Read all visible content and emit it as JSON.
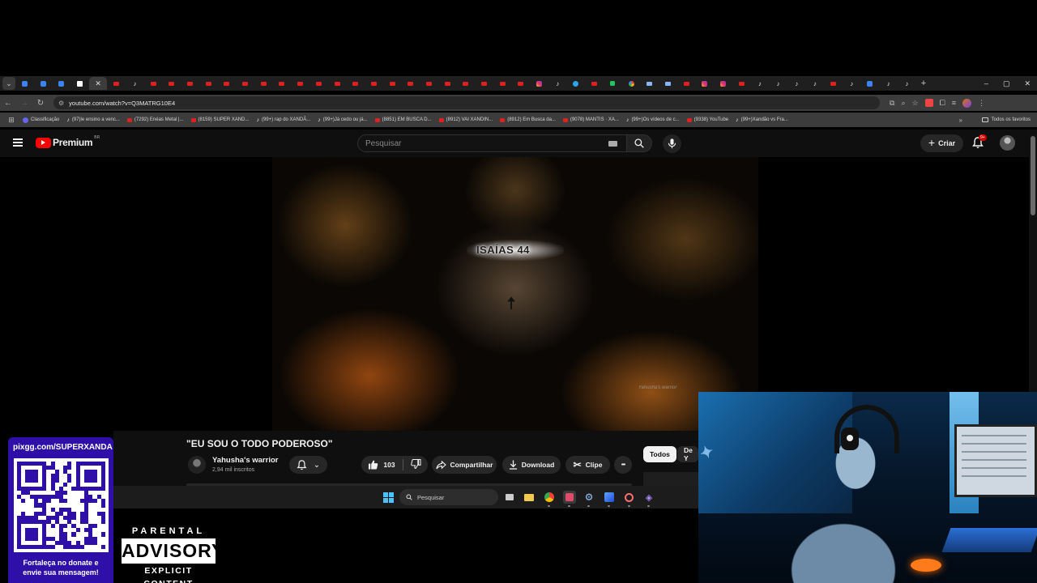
{
  "browser": {
    "tabs": [
      "menu",
      "chrome",
      "edge",
      "edge",
      "white",
      "close",
      "yt",
      "tiktok",
      "yt",
      "yt",
      "yt",
      "yt",
      "yt",
      "yt",
      "yt",
      "yt",
      "yt",
      "yt",
      "yt",
      "yt",
      "yt",
      "yt",
      "yt",
      "yt",
      "yt",
      "yt",
      "yt",
      "yt",
      "yt",
      "ig",
      "tiktok",
      "cyan",
      "yt",
      "green",
      "google",
      "grey",
      "grey",
      "yt",
      "ig",
      "ig",
      "yt",
      "tiktok",
      "tiktok",
      "tiktok",
      "tiktok",
      "yt",
      "tiktok",
      "blue",
      "tiktok",
      "tiktok"
    ],
    "new_tab_label": "+",
    "window_controls": [
      "–",
      "▢",
      "✕"
    ],
    "url": "youtube.com/watch?v=Q3MATRG10E4",
    "bookmarks": [
      {
        "label": "Classificação",
        "icon": "cls"
      },
      {
        "label": "(97)le ensino a venc...",
        "icon": "tt"
      },
      {
        "label": "(7292) Enéas Metal |...",
        "icon": "yt"
      },
      {
        "label": "(8159) SUPER XAND...",
        "icon": "yt"
      },
      {
        "label": "(99+) rap do XANDÃ...",
        "icon": "tt"
      },
      {
        "label": "(99+)Já cedo ou já...",
        "icon": "tt"
      },
      {
        "label": "(8851) EM BUSCA D...",
        "icon": "yt"
      },
      {
        "label": "(8912) VAI XANDIN...",
        "icon": "yt"
      },
      {
        "label": "(8912) Em Busca da...",
        "icon": "yt"
      },
      {
        "label": "(9078) MANTIS · XA...",
        "icon": "yt"
      },
      {
        "label": "(99+)Os vídeos de c...",
        "icon": "tt"
      },
      {
        "label": "(9338) YouTube",
        "icon": "yt"
      },
      {
        "label": "(99+)Xandão vs Fra...",
        "icon": "tt"
      }
    ],
    "bookmarks_more": "»",
    "all_bookmarks": "Todos os favoritos"
  },
  "youtube": {
    "logo_text": "Premium",
    "country": "BR",
    "search_placeholder": "Pesquisar",
    "create_label": "Criar",
    "notif_badge": "9+",
    "video_overlay_title": "ISAÍAS 44",
    "video_watermark": "Yahusha's warrior",
    "video_title": "\"EU SOU O TODO PODEROSO\"",
    "channel_name": "Yahusha's warrior",
    "channel_subs": "2,94 mil inscritos",
    "likes": "103",
    "share_label": "Compartilhar",
    "download_label": "Download",
    "clip_label": "Clipe",
    "more_label": "•••",
    "chips": [
      "Todos",
      "De Y"
    ]
  },
  "taskbar": {
    "search_label": "Pesquisar"
  },
  "overlay": {
    "qr_url": "pixgg.com/SUPERXANDA",
    "qr_text_line1": "Fortaleça no donate e",
    "qr_text_line2": "envie sua mensagem!",
    "advisory_top": "PARENTAL",
    "advisory_mid": "ADVISORY",
    "advisory_bottom": "EXPLICIT CONTENT"
  },
  "colors": {
    "yt_red": "#ff0000",
    "qr_panel": "#2e0fa8",
    "dark_bg": "#0f0f0f"
  }
}
